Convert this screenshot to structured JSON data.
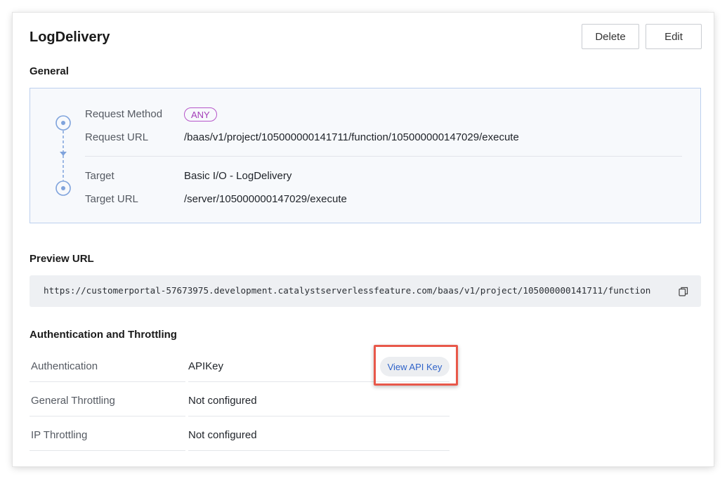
{
  "header": {
    "title": "LogDelivery",
    "delete_label": "Delete",
    "edit_label": "Edit"
  },
  "general": {
    "heading": "General",
    "request_method_label": "Request Method",
    "request_method_value": "ANY",
    "request_url_label": "Request URL",
    "request_url_value": "/baas/v1/project/105000000141711/function/105000000147029/execute",
    "target_label": "Target",
    "target_value": "Basic I/O - LogDelivery",
    "target_url_label": "Target URL",
    "target_url_value": "/server/105000000147029/execute"
  },
  "preview": {
    "heading": "Preview URL",
    "url": "https://customerportal-57673975.development.catalystserverlessfeature.com/baas/v1/project/105000000141711/function"
  },
  "auth": {
    "heading": "Authentication and Throttling",
    "rows": [
      {
        "label": "Authentication",
        "value": "APIKey"
      },
      {
        "label": "General Throttling",
        "value": "Not configured"
      },
      {
        "label": "IP Throttling",
        "value": "Not configured"
      }
    ],
    "view_key_label": "View API Key"
  },
  "colors": {
    "accent_link": "#2f63c9",
    "badge": "#a33db8",
    "highlight": "#e8584a",
    "flow_line": "#7fa3dc"
  }
}
